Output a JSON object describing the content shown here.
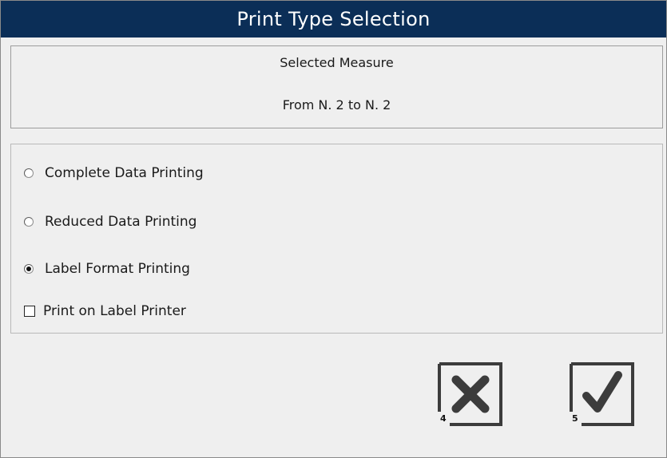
{
  "window": {
    "title": "Print Type Selection"
  },
  "info": {
    "heading": "Selected Measure",
    "range": "From N. 2  to N. 2"
  },
  "options": [
    {
      "label": "Complete Data Printing",
      "selected": false
    },
    {
      "label": "Reduced Data Printing",
      "selected": false
    },
    {
      "label": "Label Format Printing",
      "selected": true
    }
  ],
  "checkbox": {
    "label": "Print on Label Printer",
    "checked": false
  },
  "buttons": {
    "cancel": {
      "icon": "close-icon",
      "key": "4"
    },
    "ok": {
      "icon": "checkmark-icon",
      "key": "5"
    }
  },
  "colors": {
    "titlebar": "#0b2e57",
    "background": "#efefef",
    "icon": "#3c3c3c"
  }
}
